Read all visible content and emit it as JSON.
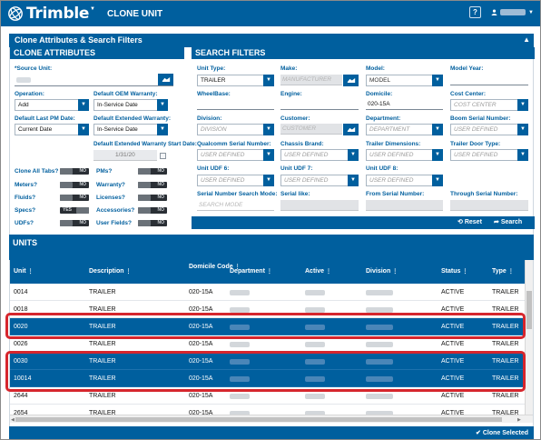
{
  "app": {
    "brand": "Trimble",
    "page_title": "CLONE UNIT",
    "help_label": "?"
  },
  "panel": {
    "title": "Clone Attributes & Search Filters"
  },
  "clone_attributes": {
    "title": "CLONE ATTRIBUTES",
    "source_unit_label": "*Source Unit:",
    "operation_label": "Operation:",
    "operation_value": "Add",
    "default_oem_warranty_label": "Default OEM Warranty:",
    "default_oem_warranty_value": "In-Service Date",
    "default_last_pm_label": "Default Last PM Date:",
    "default_last_pm_value": "Current Date",
    "default_extended_warranty_label": "Default Extended Warranty:",
    "default_extended_warranty_value": "In-Service Date",
    "default_extended_start_label": "Default Extended Warranty Start Date:",
    "default_extended_start_value": "1/31/20",
    "toggles": [
      {
        "label": "Clone All Tabs?",
        "state": "NO"
      },
      {
        "label": "PMs?",
        "state": "NO"
      },
      {
        "label": "Meters?",
        "state": "NO"
      },
      {
        "label": "Warranty?",
        "state": "NO"
      },
      {
        "label": "Fluids?",
        "state": "NO"
      },
      {
        "label": "Licenses?",
        "state": "NO"
      },
      {
        "label": "Specs?",
        "state": "YES"
      },
      {
        "label": "Accessories?",
        "state": "NO"
      },
      {
        "label": "UDFs?",
        "state": "NO"
      },
      {
        "label": "User Fields?",
        "state": "NO"
      }
    ]
  },
  "search_filters": {
    "title": "SEARCH FILTERS",
    "unit_type_label": "Unit Type:",
    "unit_type_value": "TRAILER",
    "make_label": "Make:",
    "make_placeholder": "MANUFACTURER",
    "model_label": "Model:",
    "model_value": "MODEL",
    "model_year_label": "Model Year:",
    "wheelbase_label": "WheelBase:",
    "engine_label": "Engine:",
    "domicile_label": "Domicile:",
    "domicile_value": "020-15A",
    "cost_center_label": "Cost Center:",
    "cost_center_value": "COST CENTER",
    "division_label": "Division:",
    "division_value": "DIVISION",
    "customer_label": "Customer:",
    "customer_placeholder": "CUSTOMER",
    "department_label": "Department:",
    "department_value": "DEPARTMENT",
    "boom_serial_label": "Boom Serial Number:",
    "boom_serial_value": "USER DEFINED",
    "qualcomm_label": "Qualcomm Serial Number:",
    "qualcomm_value": "USER DEFINED",
    "chassis_label": "Chassis Brand:",
    "chassis_value": "USER DEFINED",
    "trailer_dim_label": "Trailer Dimensions:",
    "trailer_dim_value": "USER DEFINED",
    "trailer_door_label": "Trailer Door Type:",
    "trailer_door_value": "USER DEFINED",
    "udf6_label": "Unit UDF 6:",
    "udf6_value": "USER DEFINED",
    "udf7_label": "Unit UDF 7:",
    "udf7_value": "USER DEFINED",
    "udf8_label": "Unit UDF 8:",
    "udf8_value": "USER DEFINED",
    "serial_mode_label": "Serial Number Search Mode:",
    "serial_mode_placeholder": "SEARCH MODE",
    "serial_like_label": "Serial like:",
    "from_serial_label": "From Serial Number:",
    "through_serial_label": "Through Serial Number:",
    "reset_label": "Reset",
    "search_label": "Search"
  },
  "units": {
    "title": "UNITS",
    "columns": [
      "Unit",
      "Description",
      "Domicile Code",
      "Department",
      "Active",
      "Division",
      "Status",
      "Type"
    ],
    "rows": [
      {
        "unit": "0014",
        "description": "TRAILER",
        "domicile": "020-15A",
        "status": "ACTIVE",
        "type": "TRAILER",
        "selected": false
      },
      {
        "unit": "0018",
        "description": "TRAILER",
        "domicile": "020-15A",
        "status": "ACTIVE",
        "type": "TRAILER",
        "selected": false
      },
      {
        "unit": "0020",
        "description": "TRAILER",
        "domicile": "020-15A",
        "status": "ACTIVE",
        "type": "TRAILER",
        "selected": true
      },
      {
        "unit": "0026",
        "description": "TRAILER",
        "domicile": "020-15A",
        "status": "ACTIVE",
        "type": "TRAILER",
        "selected": false
      },
      {
        "unit": "0030",
        "description": "TRAILER",
        "domicile": "020-15A",
        "status": "ACTIVE",
        "type": "TRAILER",
        "selected": true
      },
      {
        "unit": "10014",
        "description": "TRAILER",
        "domicile": "020-15A",
        "status": "ACTIVE",
        "type": "TRAILER",
        "selected": true
      },
      {
        "unit": "2644",
        "description": "TRAILER",
        "domicile": "020-15A",
        "status": "ACTIVE",
        "type": "TRAILER",
        "selected": false
      },
      {
        "unit": "2654",
        "description": "TRAILER",
        "domicile": "020-15A",
        "status": "ACTIVE",
        "type": "TRAILER",
        "selected": false
      }
    ],
    "clone_selected_label": "Clone Selected"
  },
  "colors": {
    "brand_blue": "#005f9e",
    "highlight_red": "#d6262d"
  }
}
